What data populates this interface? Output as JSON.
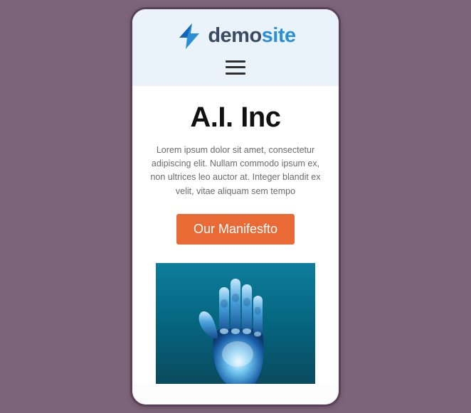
{
  "header": {
    "logo_prefix": "demo",
    "logo_suffix": "site"
  },
  "content": {
    "title": "A.I. Inc",
    "intro": "Lorem ipsum dolor sit amet, consectetur adipiscing elit. Nullam commodo ipsum ex, non ultrices leo auctor at. Integer blandit ex velit, vitae aliquam sem tempo",
    "cta_label": "Our Manifesfto"
  }
}
